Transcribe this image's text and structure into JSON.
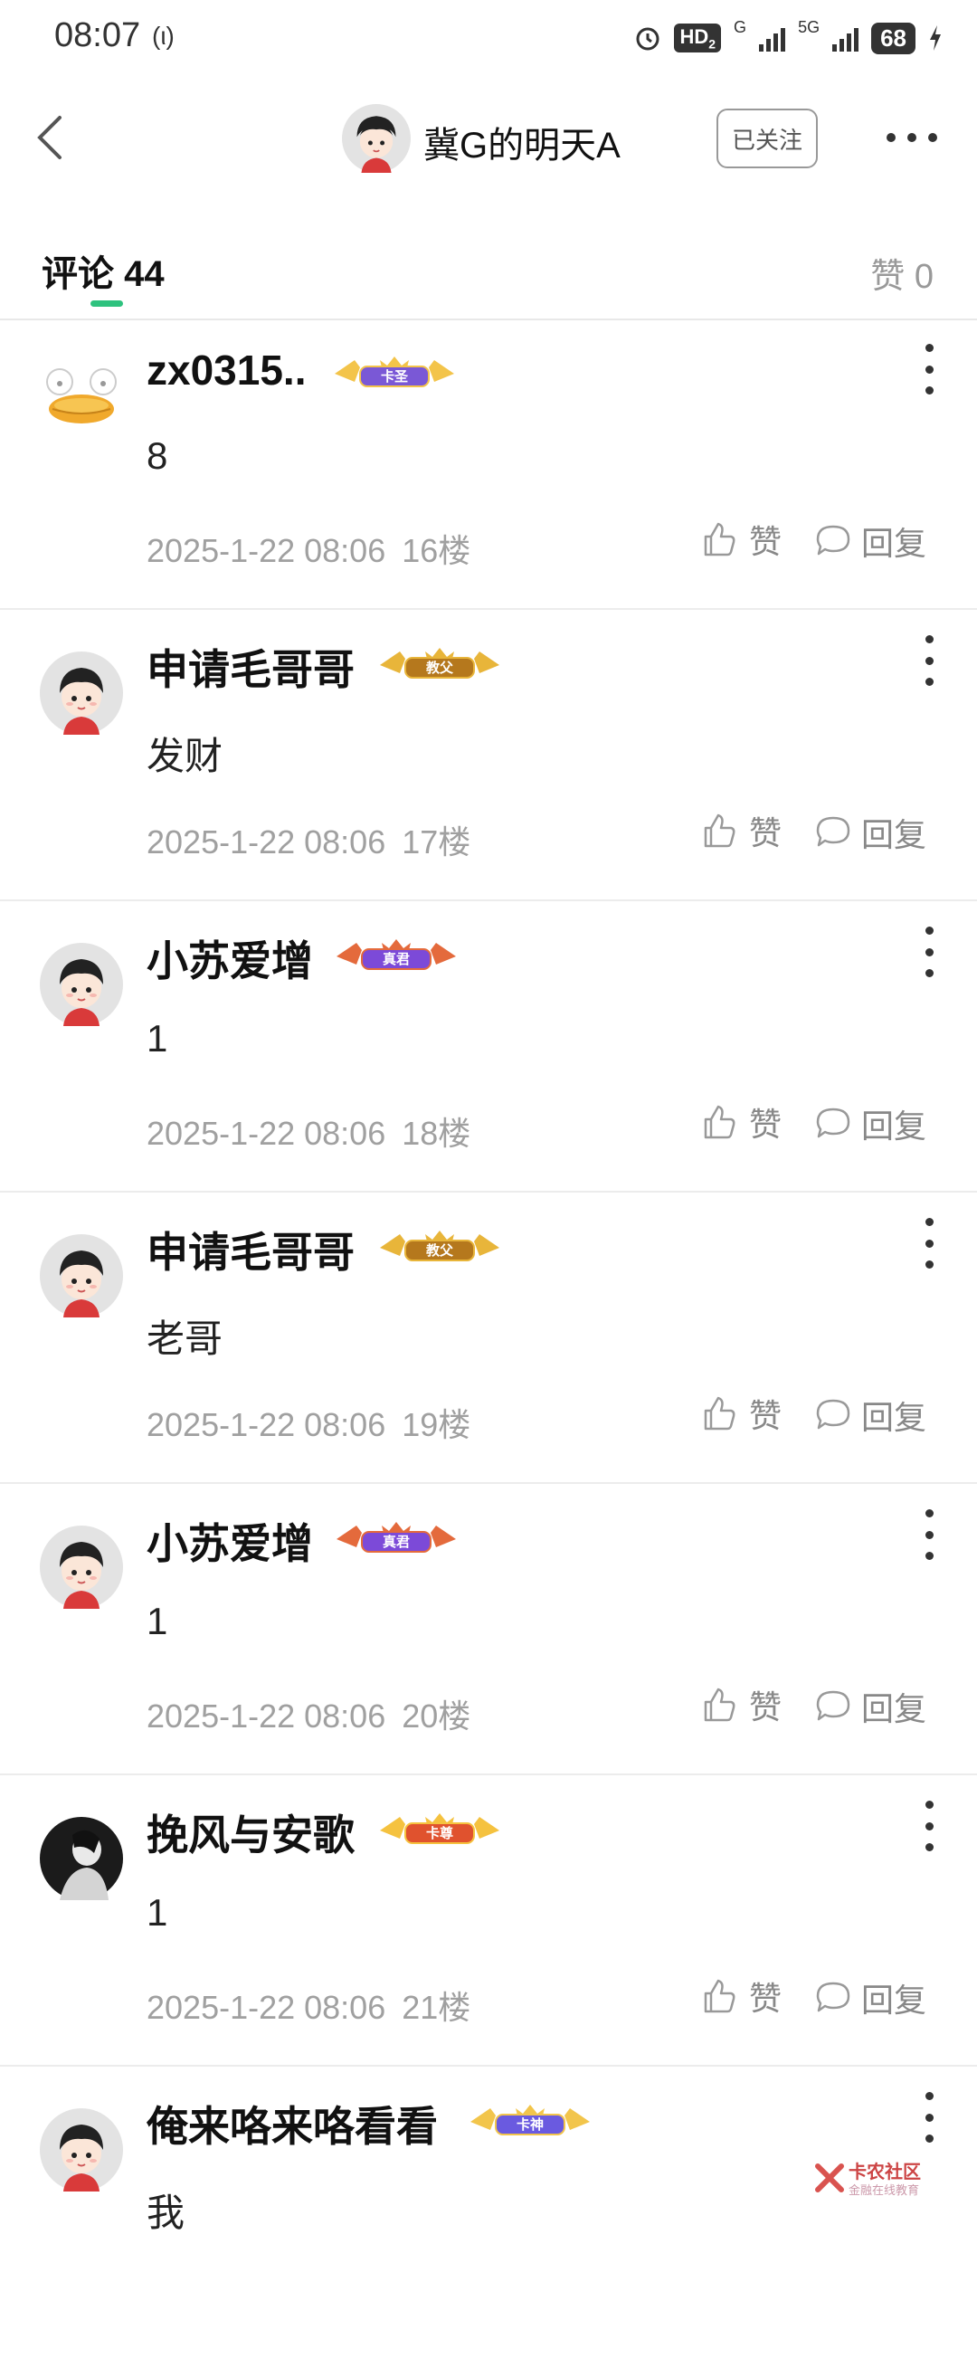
{
  "status_bar": {
    "time": "08:07",
    "call_icon": "(ι)",
    "hd_badge": "HD",
    "hd_sub": "2",
    "net1": "G",
    "net2": "5G",
    "battery": "68"
  },
  "header": {
    "back_icon": "chevron-left-icon",
    "title": "冀G的明天A",
    "follow_label": "已关注",
    "more_icon": "more-horizontal-icon"
  },
  "tabs": {
    "comment_label": "评论",
    "comment_count": "44",
    "like_label": "赞",
    "like_count": "0"
  },
  "colors": {
    "accent": "#2ec27e",
    "meta_text": "#a0a0a0",
    "divider": "#ececec"
  },
  "comments": [
    {
      "name": "zx0315..",
      "badge": "卡圣",
      "text": "8",
      "date": "2025-1-22 08:06",
      "floor": "16楼",
      "like_label": "赞",
      "reply_label": "回复",
      "avatar": "duck-avatar"
    },
    {
      "name": "申请毛哥哥",
      "badge": "教父",
      "text": "发财",
      "date": "2025-1-22 08:06",
      "floor": "17楼",
      "like_label": "赞",
      "reply_label": "回复",
      "avatar": "default-avatar"
    },
    {
      "name": "小苏爱增",
      "badge": "真君",
      "text": "1",
      "date": "2025-1-22 08:06",
      "floor": "18楼",
      "like_label": "赞",
      "reply_label": "回复",
      "avatar": "default-avatar"
    },
    {
      "name": "申请毛哥哥",
      "badge": "教父",
      "text": "老哥",
      "date": "2025-1-22 08:06",
      "floor": "19楼",
      "like_label": "赞",
      "reply_label": "回复",
      "avatar": "default-avatar"
    },
    {
      "name": "小苏爱增",
      "badge": "真君",
      "text": "1",
      "date": "2025-1-22 08:06",
      "floor": "20楼",
      "like_label": "赞",
      "reply_label": "回复",
      "avatar": "default-avatar"
    },
    {
      "name": "挽风与安歌",
      "badge": "卡尊",
      "text": "1",
      "date": "2025-1-22 08:06",
      "floor": "21楼",
      "like_label": "赞",
      "reply_label": "回复",
      "avatar": "silhouette-avatar"
    },
    {
      "name": "俺来咯来咯看看",
      "badge": "卡神",
      "text": "我",
      "date": "",
      "floor": "",
      "like_label": "",
      "reply_label": "",
      "avatar": "default-avatar"
    }
  ],
  "watermark": {
    "title": "卡农社区",
    "subtitle": "金融在线教育"
  }
}
